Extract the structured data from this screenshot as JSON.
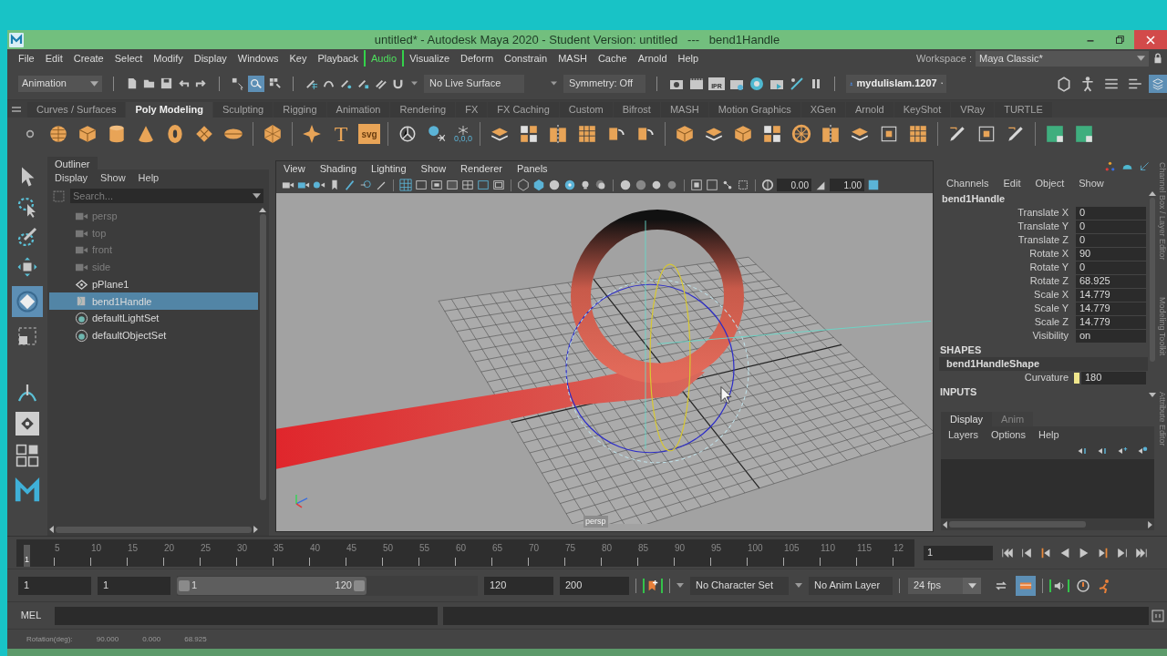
{
  "window": {
    "title": "untitled* - Autodesk Maya 2020 - Student Version: untitled   ---   bend1Handle"
  },
  "menu_bar": [
    {
      "label": "File",
      "highlighted": false
    },
    {
      "label": "Edit",
      "highlighted": false
    },
    {
      "label": "Create",
      "highlighted": false
    },
    {
      "label": "Select",
      "highlighted": false
    },
    {
      "label": "Modify",
      "highlighted": false
    },
    {
      "label": "Display",
      "highlighted": false
    },
    {
      "label": "Windows",
      "highlighted": false
    },
    {
      "label": "Key",
      "highlighted": false
    },
    {
      "label": "Playback",
      "highlighted": false
    },
    {
      "label": "Audio",
      "highlighted": true
    },
    {
      "label": "Visualize",
      "highlighted": false
    },
    {
      "label": "Deform",
      "highlighted": false
    },
    {
      "label": "Constrain",
      "highlighted": false
    },
    {
      "label": "MASH",
      "highlighted": false
    },
    {
      "label": "Cache",
      "highlighted": false
    },
    {
      "label": "Arnold",
      "highlighted": false
    },
    {
      "label": "Help",
      "highlighted": false
    }
  ],
  "workspace": {
    "label": "Workspace :",
    "value": "Maya Classic*"
  },
  "status_line": {
    "menu_set": "Animation",
    "live_surface": "No Live Surface",
    "symmetry": "Symmetry: Off",
    "user": "mydulislam.1207",
    "render_label": "IPR"
  },
  "shelf_tabs": [
    {
      "label": "Curves / Surfaces",
      "selected": false
    },
    {
      "label": "Poly Modeling",
      "selected": true
    },
    {
      "label": "Sculpting",
      "selected": false
    },
    {
      "label": "Rigging",
      "selected": false
    },
    {
      "label": "Animation",
      "selected": false
    },
    {
      "label": "Rendering",
      "selected": false
    },
    {
      "label": "FX",
      "selected": false
    },
    {
      "label": "FX Caching",
      "selected": false
    },
    {
      "label": "Custom",
      "selected": false
    },
    {
      "label": "Bifrost",
      "selected": false
    },
    {
      "label": "MASH",
      "selected": false
    },
    {
      "label": "Motion Graphics",
      "selected": false
    },
    {
      "label": "XGen",
      "selected": false
    },
    {
      "label": "Arnold",
      "selected": false
    },
    {
      "label": "KeyShot",
      "selected": false
    },
    {
      "label": "VRay",
      "selected": false
    },
    {
      "label": "TURTLE",
      "selected": false
    }
  ],
  "shelf": {
    "type_tool": "T",
    "svg_tool": "svg",
    "origin_tool": "0,0,0"
  },
  "outliner": {
    "title": "Outliner",
    "menu": [
      "Display",
      "Show",
      "Help"
    ],
    "search_placeholder": "Search...",
    "items": [
      {
        "label": "persp",
        "kind": "camera",
        "dimmed": true,
        "selected": false
      },
      {
        "label": "top",
        "kind": "camera",
        "dimmed": true,
        "selected": false
      },
      {
        "label": "front",
        "kind": "camera",
        "dimmed": true,
        "selected": false
      },
      {
        "label": "side",
        "kind": "camera",
        "dimmed": true,
        "selected": false
      },
      {
        "label": "pPlane1",
        "kind": "mesh",
        "dimmed": false,
        "selected": false
      },
      {
        "label": "bend1Handle",
        "kind": "deformer",
        "dimmed": false,
        "selected": true
      },
      {
        "label": "defaultLightSet",
        "kind": "set",
        "dimmed": false,
        "selected": false
      },
      {
        "label": "defaultObjectSet",
        "kind": "set",
        "dimmed": false,
        "selected": false
      }
    ]
  },
  "viewport": {
    "menu": [
      "View",
      "Shading",
      "Lighting",
      "Show",
      "Renderer",
      "Panels"
    ],
    "near_value": "0.00",
    "far_value": "1.00",
    "camera_label": "persp"
  },
  "channel_box": {
    "menu": [
      "Channels",
      "Edit",
      "Object",
      "Show"
    ],
    "object": "bend1Handle",
    "channels": [
      {
        "name": "Translate X",
        "value": "0"
      },
      {
        "name": "Translate Y",
        "value": "0"
      },
      {
        "name": "Translate Z",
        "value": "0"
      },
      {
        "name": "Rotate X",
        "value": "90"
      },
      {
        "name": "Rotate Y",
        "value": "0"
      },
      {
        "name": "Rotate Z",
        "value": "68.925"
      },
      {
        "name": "Scale X",
        "value": "14.779"
      },
      {
        "name": "Scale Y",
        "value": "14.779"
      },
      {
        "name": "Scale Z",
        "value": "14.779"
      },
      {
        "name": "Visibility",
        "value": "on"
      }
    ],
    "shapes_heading": "SHAPES",
    "shape": "bend1HandleShape",
    "shape_channels": [
      {
        "name": "Curvature",
        "value": "180",
        "keyed": true
      }
    ],
    "inputs_heading": "INPUTS"
  },
  "layer_editor": {
    "tabs": [
      {
        "label": "Display",
        "selected": true
      },
      {
        "label": "Anim",
        "selected": false
      }
    ],
    "menu": [
      "Layers",
      "Options",
      "Help"
    ]
  },
  "side_tabs": [
    "Channel Box / Layer Editor",
    "Modeling Toolkit",
    "Attribute Editor"
  ],
  "timeline": {
    "ticks": [
      "5",
      "10",
      "15",
      "20",
      "25",
      "30",
      "35",
      "40",
      "45",
      "50",
      "55",
      "60",
      "65",
      "70",
      "75",
      "80",
      "85",
      "90",
      "95",
      "100",
      "105",
      "110",
      "115",
      "12"
    ],
    "current_marker": "1",
    "current_frame": "1"
  },
  "range": {
    "level": 0.63,
    "start": "1",
    "playback_start": "1",
    "slider_start": "1",
    "slider_end": "120",
    "playback_end": "120",
    "end": "200",
    "character_set": "No Character Set",
    "anim_layer": "No Anim Layer",
    "fps": "24 fps"
  },
  "command_line": {
    "label": "MEL"
  },
  "help_line": {
    "label": "Rotation(deg):",
    "values": [
      "90.000",
      "0.000",
      "68.925"
    ]
  }
}
